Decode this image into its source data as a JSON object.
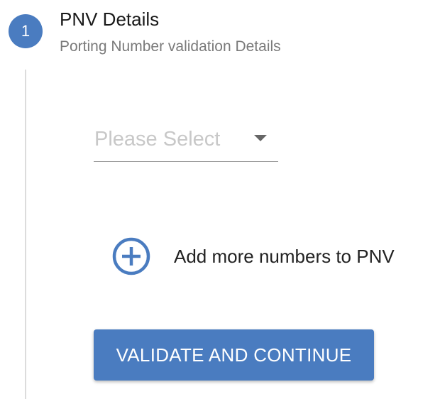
{
  "step": {
    "number": "1",
    "title": "PNV Details",
    "subtitle": "Porting Number validation Details"
  },
  "form": {
    "select_placeholder": "Please Select",
    "add_more_label": "Add more numbers to PNV",
    "primary_button_label": "VALIDATE AND CONTINUE"
  },
  "icons": {
    "add": "plus-circle-icon",
    "dropdown": "caret-down-icon"
  },
  "colors": {
    "accent": "#4a7cc0",
    "title_text": "#1a1a1a",
    "subtitle_text": "#7a7a7a",
    "placeholder_text": "#c8c8c8",
    "divider": "#dcdcdc"
  }
}
